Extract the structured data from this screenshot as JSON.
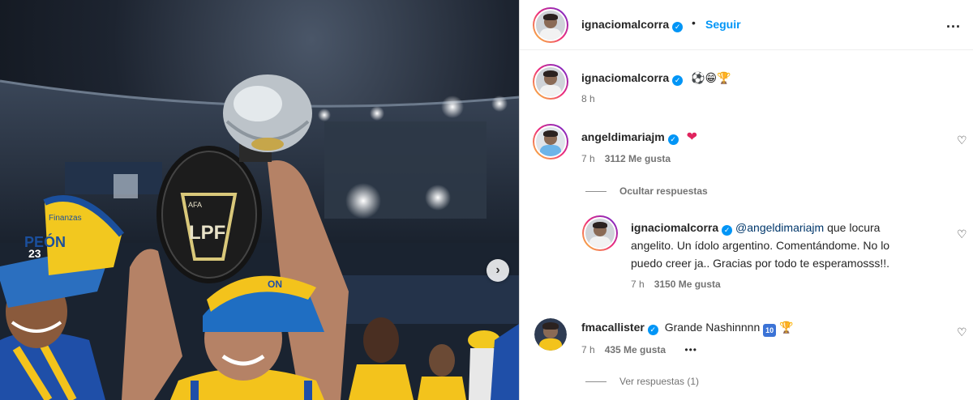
{
  "post": {
    "author": "ignaciomalcorra",
    "follow_label": "Seguir",
    "separator": "•",
    "more_label": "...",
    "next_label": "›"
  },
  "caption": {
    "author": "ignaciomalcorra",
    "text": "⚽😁🏆",
    "time": "8 h"
  },
  "comments": [
    {
      "author": "angeldimariajm",
      "text": "❤",
      "time": "7 h",
      "likes": "3112 Me gusta",
      "like_icon": "♡"
    },
    {
      "author": "fmacallister",
      "text_main": "Grande Nashinnnn",
      "badge": "10",
      "trophy": "🏆",
      "time": "7 h",
      "likes": "435 Me gusta",
      "options": "•••",
      "like_icon": "♡"
    }
  ],
  "hide_replies": "Ocultar respuestas",
  "reply": {
    "author": "ignaciomalcorra",
    "mention": "@angeldimariajm",
    "line1_rest": " que locura",
    "line2": "angelito. Un ídolo argentino. Comentándome. No lo",
    "line3": "puedo creer ja.. Gracias por todo te esperamosss!!.",
    "time": "7 h",
    "likes": "3150 Me gusta",
    "like_icon": "♡"
  },
  "view_replies": "Ver respuestas (1)",
  "photo": {
    "hat_text_1": "Finanzas",
    "hat_text_2": "PEÓN",
    "hat_text_3": "23",
    "trophy_text": "LPF",
    "trophy_top": "AFA"
  }
}
